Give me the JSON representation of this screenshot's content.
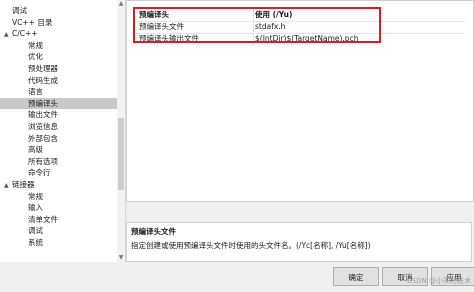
{
  "tree": {
    "items": [
      {
        "label": "调试",
        "indent": 1,
        "expander": "",
        "selected": false
      },
      {
        "label": "VC++ 目录",
        "indent": 1,
        "expander": "",
        "selected": false
      },
      {
        "label": "C/C++",
        "indent": 1,
        "expander": "▲",
        "selected": false
      },
      {
        "label": "常规",
        "indent": 2,
        "expander": "",
        "selected": false
      },
      {
        "label": "优化",
        "indent": 2,
        "expander": "",
        "selected": false
      },
      {
        "label": "预处理器",
        "indent": 2,
        "expander": "",
        "selected": false
      },
      {
        "label": "代码生成",
        "indent": 2,
        "expander": "",
        "selected": false
      },
      {
        "label": "语言",
        "indent": 2,
        "expander": "",
        "selected": false
      },
      {
        "label": "预编译头",
        "indent": 2,
        "expander": "",
        "selected": true
      },
      {
        "label": "输出文件",
        "indent": 2,
        "expander": "",
        "selected": false
      },
      {
        "label": "浏览信息",
        "indent": 2,
        "expander": "",
        "selected": false
      },
      {
        "label": "外部包含",
        "indent": 2,
        "expander": "",
        "selected": false
      },
      {
        "label": "高级",
        "indent": 2,
        "expander": "",
        "selected": false
      },
      {
        "label": "所有选项",
        "indent": 2,
        "expander": "",
        "selected": false
      },
      {
        "label": "命令行",
        "indent": 2,
        "expander": "",
        "selected": false
      },
      {
        "label": "链接器",
        "indent": 1,
        "expander": "▲",
        "selected": false
      },
      {
        "label": "常规",
        "indent": 2,
        "expander": "",
        "selected": false
      },
      {
        "label": "输入",
        "indent": 2,
        "expander": "",
        "selected": false
      },
      {
        "label": "清单文件",
        "indent": 2,
        "expander": "",
        "selected": false
      },
      {
        "label": "调试",
        "indent": 2,
        "expander": "",
        "selected": false
      },
      {
        "label": "系统",
        "indent": 2,
        "expander": "",
        "selected": false
      }
    ]
  },
  "properties": [
    {
      "name": "预编译头",
      "value": "使用 (/Yu)",
      "bold": true
    },
    {
      "name": "预编译头文件",
      "value": "stdafx.h",
      "bold": false
    },
    {
      "name": "预编译头输出文件",
      "value": "$(IntDir)$(TargetName).pch",
      "bold": false
    }
  ],
  "description": {
    "title": "预编译头文件",
    "text": "指定创建或使用预编译头文件时使用的头文件名。(/Yc[名称], /Yu[名称])"
  },
  "buttons": {
    "ok": "确定",
    "cancel": "取消",
    "apply": "应用"
  },
  "watermark": "CSDN @小乖的技术",
  "colors": {
    "highlight": "#e11b1b",
    "selected": "#c9c9cb"
  }
}
